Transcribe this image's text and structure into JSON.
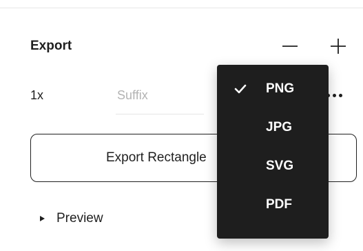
{
  "export_panel": {
    "title": "Export",
    "remove_icon": "minus-icon",
    "add_icon": "plus-icon",
    "scale": "1x",
    "suffix_value": "",
    "suffix_placeholder": "Suffix",
    "more_icon": "more-dots-icon",
    "export_button_label": "Export Rectangle",
    "preview_label": "Preview"
  },
  "format_menu": {
    "items": [
      {
        "label": "PNG",
        "selected": true
      },
      {
        "label": "JPG",
        "selected": false
      },
      {
        "label": "SVG",
        "selected": false
      },
      {
        "label": "PDF",
        "selected": false
      }
    ],
    "check_icon": "checkmark-icon",
    "background": "#1e1e1e",
    "text_color": "#ffffff"
  }
}
